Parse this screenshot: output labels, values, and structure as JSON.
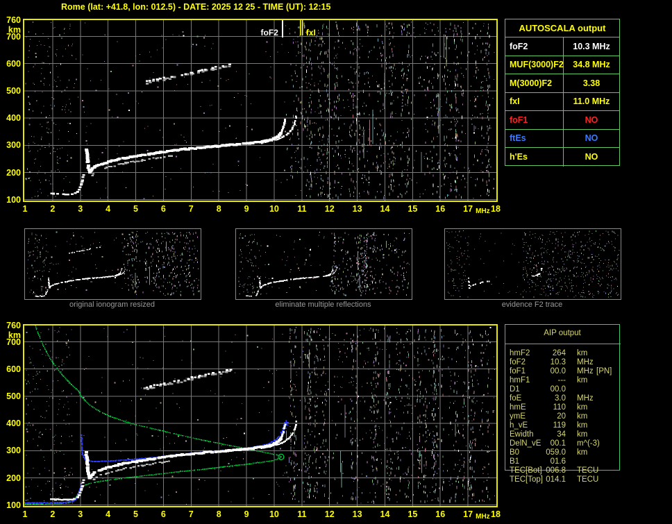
{
  "header": {
    "title": "Rome (lat: +41.8, lon: 012.5) - DATE: 2025 12 25 - TIME (UT): 12:15"
  },
  "colors": {
    "background": "#000000",
    "axis_yellow": "#ffff00",
    "plot_border": "#e8e800",
    "grid_gray": "#7a7a7a",
    "trace_white": "#ffffff",
    "echo_gray": "#b9b9b9",
    "profile_green": "#00c23a",
    "fitted_blue": "#2b3cff",
    "value_red": "#ff2222",
    "value_blue": "#3b7cff",
    "aip_text": "#d6d66e",
    "caption_gray": "#9a9a9a",
    "table_border_autoscala": "#61c861",
    "table_border_aip": "#3dc96b"
  },
  "axes": {
    "freq_ticks": [
      1,
      2,
      3,
      4,
      5,
      6,
      7,
      8,
      9,
      10,
      11,
      12,
      13,
      14,
      15,
      16,
      17,
      18
    ],
    "freq_unit": "MHz",
    "height_ticks": [
      760,
      700,
      600,
      500,
      400,
      300,
      200,
      100
    ],
    "height_unit": "km"
  },
  "autoscala": {
    "title": "AUTOSCALA output",
    "rows": [
      {
        "label": "foF2",
        "value": "10.3 MHz",
        "color": "white"
      },
      {
        "label": "MUF(3000)F2",
        "value": "34.8 MHz",
        "color": "yellow"
      },
      {
        "label": "M(3000)F2",
        "value": "3.38",
        "color": "yellow"
      },
      {
        "label": "fxI",
        "value": "11.0 MHz",
        "color": "yellow"
      },
      {
        "label": "foF1",
        "value": "NO",
        "color": "red"
      },
      {
        "label": "ftEs",
        "value": "NO",
        "color": "blue"
      },
      {
        "label": "h'Es",
        "value": "NO",
        "color": "yellow"
      }
    ]
  },
  "aip": {
    "title": "AIP output",
    "rows": [
      {
        "label": "hmF2",
        "value": "264",
        "unit": "km",
        "extra": ""
      },
      {
        "label": "foF2",
        "value": "10.3",
        "unit": "MHz",
        "extra": ""
      },
      {
        "label": "foF1",
        "value": "00.0",
        "unit": "MHz",
        "extra": "[PN]"
      },
      {
        "label": "hmF1",
        "value": "---",
        "unit": "km",
        "extra": ""
      },
      {
        "label": "D1",
        "value": "00.0",
        "unit": "",
        "extra": ""
      },
      {
        "label": "foE",
        "value": "3.0",
        "unit": "MHz",
        "extra": ""
      },
      {
        "label": "hmE",
        "value": "110",
        "unit": "km",
        "extra": ""
      },
      {
        "label": "ymE",
        "value": "20",
        "unit": "km",
        "extra": ""
      },
      {
        "label": "h_vE",
        "value": "119",
        "unit": "km",
        "extra": ""
      },
      {
        "label": "Ewidth",
        "value": "34",
        "unit": "km",
        "extra": ""
      },
      {
        "label": "DelN_vE",
        "value": "00.1",
        "unit": "m^(-3)",
        "extra": ""
      },
      {
        "label": "B0",
        "value": "059.0",
        "unit": "km",
        "extra": ""
      },
      {
        "label": "B1",
        "value": "01.6",
        "unit": "",
        "extra": ""
      },
      {
        "label": "TEC[Bot]",
        "value": "006.8",
        "unit": "TECU",
        "extra": ""
      },
      {
        "label": "TEC[Top]",
        "value": "014.1",
        "unit": "TECU",
        "extra": ""
      }
    ]
  },
  "thumbnails": [
    {
      "caption": "original ionogram resized"
    },
    {
      "caption": "eliminate multiple reflections"
    },
    {
      "caption": "evidence F2 trace"
    }
  ],
  "chart_data": {
    "type": "scatter",
    "xlabel": "MHz",
    "ylabel": "km",
    "xlim": [
      1,
      18
    ],
    "ylim": [
      90,
      760
    ],
    "grid": true,
    "x_ticks": [
      1,
      2,
      3,
      4,
      5,
      6,
      7,
      8,
      9,
      10,
      11,
      12,
      13,
      14,
      15,
      16,
      17,
      18
    ],
    "y_ticks": [
      760,
      700,
      600,
      500,
      400,
      300,
      200,
      100
    ],
    "ionogram_trace": {
      "e_region": [
        [
          1.95,
          122
        ],
        [
          2.1,
          121
        ],
        [
          2.25,
          120
        ],
        [
          2.4,
          120
        ],
        [
          2.55,
          120
        ],
        [
          2.7,
          121
        ],
        [
          2.82,
          124
        ],
        [
          2.9,
          129
        ],
        [
          2.96,
          137
        ],
        [
          3.0,
          147
        ],
        [
          3.04,
          159
        ],
        [
          3.07,
          171
        ],
        [
          3.1,
          183
        ],
        [
          3.12,
          194
        ]
      ],
      "f_region": [
        [
          3.22,
          292
        ],
        [
          3.24,
          266
        ],
        [
          3.27,
          238
        ],
        [
          3.3,
          214
        ],
        [
          3.33,
          200
        ],
        [
          3.38,
          206
        ],
        [
          3.45,
          214
        ],
        [
          3.55,
          222
        ],
        [
          3.7,
          228
        ],
        [
          3.9,
          235
        ],
        [
          4.1,
          241
        ],
        [
          4.35,
          247
        ],
        [
          4.6,
          253
        ],
        [
          4.9,
          258
        ],
        [
          5.2,
          263
        ],
        [
          5.5,
          268
        ],
        [
          5.9,
          274
        ],
        [
          6.3,
          280
        ],
        [
          6.7,
          285
        ],
        [
          7.1,
          289
        ],
        [
          7.5,
          293
        ],
        [
          7.9,
          296
        ],
        [
          8.3,
          300
        ],
        [
          8.7,
          303
        ],
        [
          9.1,
          307
        ],
        [
          9.5,
          312
        ],
        [
          9.8,
          318
        ],
        [
          10.0,
          325
        ],
        [
          10.15,
          333
        ],
        [
          10.25,
          343
        ]
      ],
      "f_cusp_ordinary": [
        [
          9.9,
          321
        ],
        [
          10.08,
          330
        ],
        [
          10.2,
          341
        ],
        [
          10.29,
          355
        ],
        [
          10.34,
          369
        ],
        [
          10.37,
          383
        ],
        [
          10.39,
          396
        ]
      ],
      "f_cusp_extraordinary": [
        [
          9.55,
          309
        ],
        [
          9.85,
          315
        ],
        [
          10.12,
          322
        ],
        [
          10.35,
          332
        ],
        [
          10.53,
          345
        ],
        [
          10.65,
          360
        ],
        [
          10.73,
          378
        ],
        [
          10.78,
          395
        ],
        [
          10.8,
          410
        ]
      ],
      "second_hop_echo": [
        [
          5.3,
          532
        ],
        [
          5.55,
          537
        ],
        [
          5.8,
          542
        ],
        [
          6.05,
          548
        ],
        [
          6.3,
          552
        ],
        [
          6.55,
          557
        ],
        [
          6.8,
          562
        ],
        [
          7.05,
          568
        ],
        [
          7.3,
          574
        ],
        [
          7.55,
          580
        ],
        [
          7.8,
          585
        ],
        [
          8.05,
          590
        ],
        [
          8.3,
          594
        ],
        [
          8.5,
          598
        ]
      ]
    },
    "top_plot": {
      "markers": {
        "foF2_MHz": 10.3,
        "fxI_MHz": 10.95
      },
      "marker_labels": {
        "foF2": "foF2",
        "fxI": "fxI"
      }
    },
    "bottom_plot": {
      "electron_density_profile_green": [
        [
          1.38,
          760
        ],
        [
          1.48,
          730
        ],
        [
          1.6,
          700
        ],
        [
          1.75,
          668
        ],
        [
          1.9,
          640
        ],
        [
          2.05,
          618
        ],
        [
          2.18,
          600
        ],
        [
          2.35,
          578
        ],
        [
          2.55,
          556
        ],
        [
          2.75,
          536
        ],
        [
          2.95,
          518
        ],
        [
          3.0,
          505
        ],
        [
          3.1,
          492
        ],
        [
          3.3,
          471
        ],
        [
          3.55,
          453
        ],
        [
          3.8,
          439
        ],
        [
          4.1,
          425
        ],
        [
          4.5,
          411
        ],
        [
          4.9,
          398
        ],
        [
          5.4,
          386
        ],
        [
          5.9,
          374
        ],
        [
          6.4,
          362
        ],
        [
          6.9,
          350
        ],
        [
          7.4,
          339
        ],
        [
          7.9,
          329
        ],
        [
          8.4,
          319
        ],
        [
          8.9,
          309
        ],
        [
          9.4,
          299
        ],
        [
          9.8,
          291
        ],
        [
          10.1,
          284
        ],
        [
          10.25,
          277
        ],
        [
          10.18,
          270
        ],
        [
          9.95,
          264
        ],
        [
          9.6,
          258
        ],
        [
          9.1,
          251
        ],
        [
          8.5,
          244
        ],
        [
          7.9,
          237
        ],
        [
          7.3,
          230
        ],
        [
          6.7,
          224
        ],
        [
          6.1,
          217
        ],
        [
          5.5,
          210
        ],
        [
          4.9,
          203
        ],
        [
          4.4,
          197
        ],
        [
          3.9,
          190
        ],
        [
          3.5,
          183
        ],
        [
          3.2,
          175
        ],
        [
          3.05,
          166
        ],
        [
          2.98,
          156
        ],
        [
          2.93,
          146
        ],
        [
          2.88,
          136
        ],
        [
          2.82,
          127
        ],
        [
          2.78,
          118
        ],
        [
          2.7,
          112
        ],
        [
          2.55,
          108
        ],
        [
          2.3,
          106
        ],
        [
          2.0,
          105
        ],
        [
          1.6,
          104
        ],
        [
          1.2,
          104
        ],
        [
          1.0,
          104
        ]
      ],
      "fitted_trace_blue": [
        [
          [
            1.0,
            108
          ],
          [
            1.3,
            108
          ],
          [
            1.6,
            108
          ],
          [
            1.9,
            109
          ],
          [
            2.2,
            109
          ],
          [
            2.5,
            110
          ],
          [
            2.65,
            112
          ],
          [
            2.78,
            116
          ],
          [
            2.85,
            123
          ],
          [
            2.9,
            132
          ],
          [
            2.95,
            146
          ],
          [
            3.0,
            160
          ],
          [
            3.02,
            174
          ]
        ],
        [
          [
            3.05,
            356
          ],
          [
            3.05,
            320
          ],
          [
            3.06,
            300
          ],
          [
            3.08,
            286
          ],
          [
            3.12,
            274
          ],
          [
            3.18,
            267
          ],
          [
            3.28,
            263
          ],
          [
            3.45,
            260
          ],
          [
            3.65,
            260
          ],
          [
            3.9,
            261
          ],
          [
            4.2,
            263
          ],
          [
            4.55,
            265
          ],
          [
            4.9,
            268
          ],
          [
            5.3,
            271
          ],
          [
            5.7,
            275
          ],
          [
            6.1,
            280
          ],
          [
            6.5,
            285
          ],
          [
            6.9,
            289
          ],
          [
            7.3,
            293
          ],
          [
            7.7,
            296
          ],
          [
            8.1,
            299
          ],
          [
            8.5,
            303
          ],
          [
            8.9,
            307
          ],
          [
            9.25,
            312
          ],
          [
            9.55,
            318
          ],
          [
            9.8,
            326
          ],
          [
            10.0,
            336
          ],
          [
            10.15,
            348
          ],
          [
            10.27,
            362
          ],
          [
            10.35,
            377
          ],
          [
            10.41,
            392
          ],
          [
            10.44,
            405
          ]
        ]
      ],
      "blue_plus_markers": [
        [
          10.3,
          368
        ],
        [
          10.36,
          382
        ],
        [
          10.41,
          394
        ],
        [
          10.44,
          404
        ]
      ],
      "profile_nose": [
        10.25,
        277
      ]
    }
  }
}
